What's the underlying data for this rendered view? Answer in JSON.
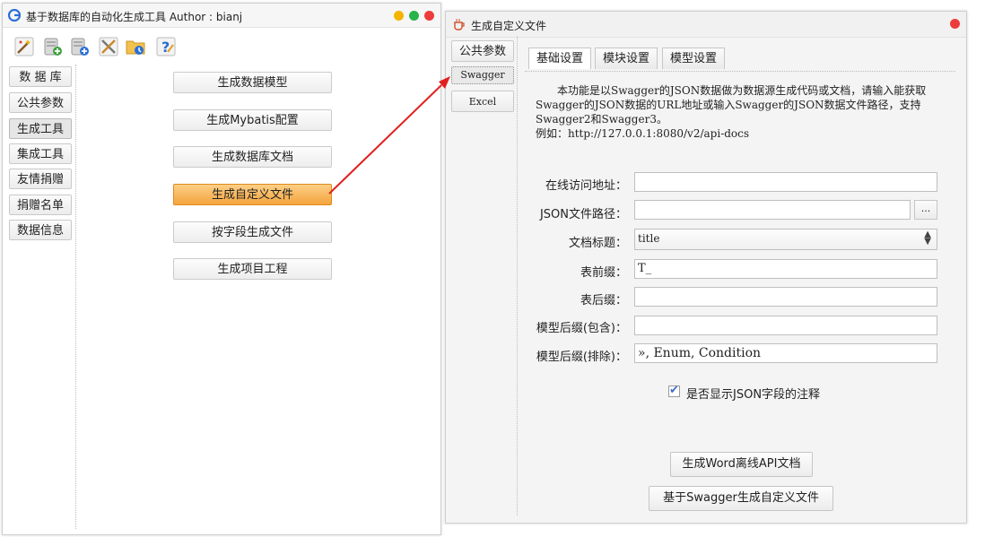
{
  "window1": {
    "title": "基于数据库的自动化生成工具  Author : bianj",
    "toolbar_icons": [
      "magic-wand-icon",
      "database-add-icon",
      "database-import-icon",
      "tools-icon",
      "folder-config-icon",
      "help-icon"
    ],
    "nav": [
      "数 据 库",
      "公共参数",
      "生成工具",
      "集成工具",
      "友情捐赠",
      "捐赠名单",
      "数据信息"
    ],
    "nav_active_index": 2,
    "actions": [
      "生成数据模型",
      "生成Mybatis配置",
      "生成数据库文档",
      "生成自定义文件",
      "按字段生成文件",
      "生成项目工程"
    ],
    "action_active_index": 3,
    "colors": {
      "active_action": "#f4a43d",
      "dot_yellow": "#f5b400",
      "dot_green": "#28b34a",
      "dot_red": "#ec3c3c"
    }
  },
  "window2": {
    "title": "生成自定义文件",
    "subnav": [
      "公共参数",
      "Swagger",
      "Excel"
    ],
    "subnav_active_index": 1,
    "tabs": [
      "基础设置",
      "模块设置",
      "模型设置"
    ],
    "tab_active_index": 0,
    "description_line1": "本功能是以Swagger的JSON数据做为数据源生成代码或文档，请输入能获取Swagger的JSON数据的URL地址或输入Swagger的JSON数据文件路径，支持Swagger2和Swagger3。",
    "description_line2": "例如：http://127.0.0.1:8080/v2/api-docs",
    "fields": {
      "url_label": "在线访问地址：",
      "url_value": "",
      "json_path_label": "JSON文件路径：",
      "json_path_value": "",
      "browse_label": "...",
      "doc_title_label": "文档标题：",
      "doc_title_value": "title",
      "prefix_label": "表前缀：",
      "prefix_value": "T_",
      "suffix_label": "表后缀：",
      "suffix_value": "",
      "model_include_label": "模型后缀(包含)：",
      "model_include_value": "",
      "model_exclude_label": "模型后缀(排除)：",
      "model_exclude_value": "», Enum, Condition"
    },
    "checkbox": {
      "label": "是否显示JSON字段的注释",
      "checked": true
    },
    "buttons": {
      "word_doc": "生成Word离线API文档",
      "custom_file": "基于Swagger生成自定义文件"
    }
  }
}
